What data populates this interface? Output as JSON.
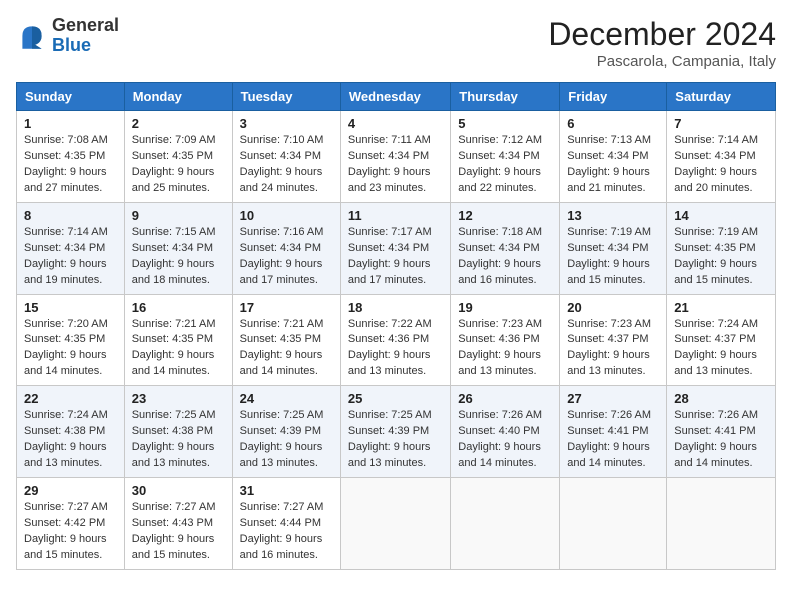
{
  "logo": {
    "general": "General",
    "blue": "Blue"
  },
  "title": "December 2024",
  "location": "Pascarola, Campania, Italy",
  "days_of_week": [
    "Sunday",
    "Monday",
    "Tuesday",
    "Wednesday",
    "Thursday",
    "Friday",
    "Saturday"
  ],
  "weeks": [
    [
      {
        "day": "1",
        "sunrise": "7:08 AM",
        "sunset": "4:35 PM",
        "daylight": "9 hours and 27 minutes."
      },
      {
        "day": "2",
        "sunrise": "7:09 AM",
        "sunset": "4:35 PM",
        "daylight": "9 hours and 25 minutes."
      },
      {
        "day": "3",
        "sunrise": "7:10 AM",
        "sunset": "4:34 PM",
        "daylight": "9 hours and 24 minutes."
      },
      {
        "day": "4",
        "sunrise": "7:11 AM",
        "sunset": "4:34 PM",
        "daylight": "9 hours and 23 minutes."
      },
      {
        "day": "5",
        "sunrise": "7:12 AM",
        "sunset": "4:34 PM",
        "daylight": "9 hours and 22 minutes."
      },
      {
        "day": "6",
        "sunrise": "7:13 AM",
        "sunset": "4:34 PM",
        "daylight": "9 hours and 21 minutes."
      },
      {
        "day": "7",
        "sunrise": "7:14 AM",
        "sunset": "4:34 PM",
        "daylight": "9 hours and 20 minutes."
      }
    ],
    [
      {
        "day": "8",
        "sunrise": "7:14 AM",
        "sunset": "4:34 PM",
        "daylight": "9 hours and 19 minutes."
      },
      {
        "day": "9",
        "sunrise": "7:15 AM",
        "sunset": "4:34 PM",
        "daylight": "9 hours and 18 minutes."
      },
      {
        "day": "10",
        "sunrise": "7:16 AM",
        "sunset": "4:34 PM",
        "daylight": "9 hours and 17 minutes."
      },
      {
        "day": "11",
        "sunrise": "7:17 AM",
        "sunset": "4:34 PM",
        "daylight": "9 hours and 17 minutes."
      },
      {
        "day": "12",
        "sunrise": "7:18 AM",
        "sunset": "4:34 PM",
        "daylight": "9 hours and 16 minutes."
      },
      {
        "day": "13",
        "sunrise": "7:19 AM",
        "sunset": "4:34 PM",
        "daylight": "9 hours and 15 minutes."
      },
      {
        "day": "14",
        "sunrise": "7:19 AM",
        "sunset": "4:35 PM",
        "daylight": "9 hours and 15 minutes."
      }
    ],
    [
      {
        "day": "15",
        "sunrise": "7:20 AM",
        "sunset": "4:35 PM",
        "daylight": "9 hours and 14 minutes."
      },
      {
        "day": "16",
        "sunrise": "7:21 AM",
        "sunset": "4:35 PM",
        "daylight": "9 hours and 14 minutes."
      },
      {
        "day": "17",
        "sunrise": "7:21 AM",
        "sunset": "4:35 PM",
        "daylight": "9 hours and 14 minutes."
      },
      {
        "day": "18",
        "sunrise": "7:22 AM",
        "sunset": "4:36 PM",
        "daylight": "9 hours and 13 minutes."
      },
      {
        "day": "19",
        "sunrise": "7:23 AM",
        "sunset": "4:36 PM",
        "daylight": "9 hours and 13 minutes."
      },
      {
        "day": "20",
        "sunrise": "7:23 AM",
        "sunset": "4:37 PM",
        "daylight": "9 hours and 13 minutes."
      },
      {
        "day": "21",
        "sunrise": "7:24 AM",
        "sunset": "4:37 PM",
        "daylight": "9 hours and 13 minutes."
      }
    ],
    [
      {
        "day": "22",
        "sunrise": "7:24 AM",
        "sunset": "4:38 PM",
        "daylight": "9 hours and 13 minutes."
      },
      {
        "day": "23",
        "sunrise": "7:25 AM",
        "sunset": "4:38 PM",
        "daylight": "9 hours and 13 minutes."
      },
      {
        "day": "24",
        "sunrise": "7:25 AM",
        "sunset": "4:39 PM",
        "daylight": "9 hours and 13 minutes."
      },
      {
        "day": "25",
        "sunrise": "7:25 AM",
        "sunset": "4:39 PM",
        "daylight": "9 hours and 13 minutes."
      },
      {
        "day": "26",
        "sunrise": "7:26 AM",
        "sunset": "4:40 PM",
        "daylight": "9 hours and 14 minutes."
      },
      {
        "day": "27",
        "sunrise": "7:26 AM",
        "sunset": "4:41 PM",
        "daylight": "9 hours and 14 minutes."
      },
      {
        "day": "28",
        "sunrise": "7:26 AM",
        "sunset": "4:41 PM",
        "daylight": "9 hours and 14 minutes."
      }
    ],
    [
      {
        "day": "29",
        "sunrise": "7:27 AM",
        "sunset": "4:42 PM",
        "daylight": "9 hours and 15 minutes."
      },
      {
        "day": "30",
        "sunrise": "7:27 AM",
        "sunset": "4:43 PM",
        "daylight": "9 hours and 15 minutes."
      },
      {
        "day": "31",
        "sunrise": "7:27 AM",
        "sunset": "4:44 PM",
        "daylight": "9 hours and 16 minutes."
      },
      null,
      null,
      null,
      null
    ]
  ],
  "labels": {
    "sunrise": "Sunrise:",
    "sunset": "Sunset:",
    "daylight": "Daylight:"
  }
}
